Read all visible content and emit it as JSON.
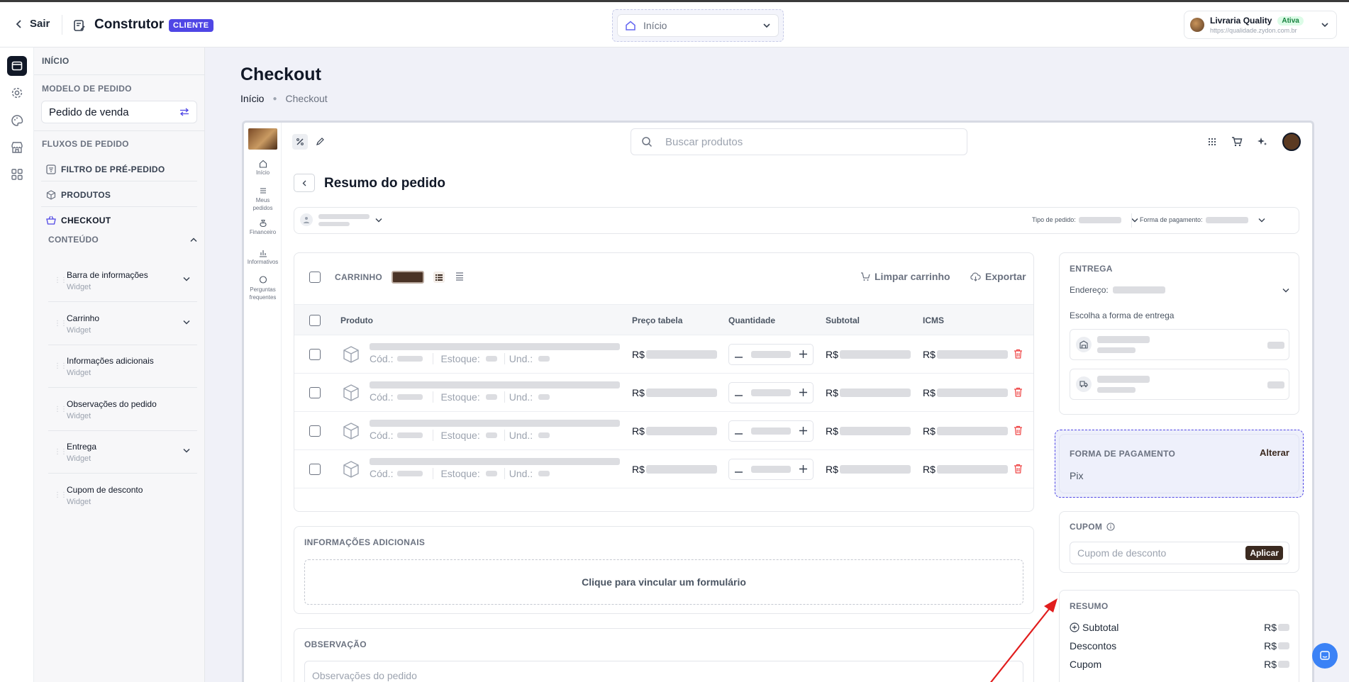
{
  "topbar": {
    "back_label": "Sair",
    "title": "Construtor",
    "badge": "CLIENTE",
    "page_select": "Início",
    "store_name": "Livraria Quality",
    "store_status": "Ativa",
    "store_url": "https://qualidade.zydon.com.br"
  },
  "sidebar": {
    "home": "INÍCIO",
    "order_model_label": "MODELO DE PEDIDO",
    "order_model_value": "Pedido de venda",
    "flows_label": "FLUXOS DE PEDIDO",
    "flows": [
      "FILTRO DE PRÉ-PEDIDO",
      "PRODUTOS",
      "CHECKOUT"
    ],
    "content_label": "CONTEÚDO",
    "widgets": [
      {
        "title": "Barra de informações",
        "sub": "Widget"
      },
      {
        "title": "Carrinho",
        "sub": "Widget"
      },
      {
        "title": "Informações adicionais",
        "sub": "Widget"
      },
      {
        "title": "Observações do pedido",
        "sub": "Widget"
      },
      {
        "title": "Entrega",
        "sub": "Widget"
      },
      {
        "title": "Cupom de desconto",
        "sub": "Widget"
      }
    ]
  },
  "page": {
    "title": "Checkout",
    "breadcrumb": [
      "Início",
      "Checkout"
    ]
  },
  "preview": {
    "nav": [
      {
        "label": "Início"
      },
      {
        "label": "Meus pedidos"
      },
      {
        "label": "Financeiro"
      },
      {
        "label": "Informativos"
      },
      {
        "label": "Perguntas frequentes"
      }
    ],
    "search_placeholder": "Buscar produtos",
    "order_title": "Resumo do pedido",
    "order_type_label": "Tipo de pedido:",
    "payment_form_label": "Forma de pagamento:",
    "cart": {
      "label": "CARRINHO",
      "clear": "Limpar carrinho",
      "export": "Exportar",
      "columns": [
        "Produto",
        "Preço tabela",
        "Quantidade",
        "Subtotal",
        "ICMS"
      ],
      "row_labels": {
        "cod": "Cód.:",
        "stock": "Estoque:",
        "unit": "Und.:",
        "currency": "R$"
      },
      "rows_count_note": "4"
    },
    "additional": {
      "label": "INFORMAÇÕES ADICIONAIS",
      "link": "Clique para vincular um formulário"
    },
    "observation": {
      "label": "OBSERVAÇÃO",
      "placeholder": "Observações do pedido"
    },
    "delivery": {
      "label": "ENTREGA",
      "address_label": "Endereço:",
      "choose": "Escolha a forma de entrega"
    },
    "payment": {
      "label": "FORMA DE PAGAMENTO",
      "change": "Alterar",
      "value": "Pix"
    },
    "coupon": {
      "label": "CUPOM",
      "placeholder": "Cupom de desconto",
      "apply": "Aplicar"
    },
    "summary": {
      "label": "RESUMO",
      "rows": [
        {
          "label": "Subtotal",
          "currency": "R$"
        },
        {
          "label": "Descontos",
          "currency": "R$"
        },
        {
          "label": "Cupom",
          "currency": "R$"
        }
      ]
    }
  },
  "colors": {
    "accent": "#4f46e5",
    "brand_dark": "#3b2a20",
    "annotation": "#e11d1d",
    "chat": "#3b82f6"
  }
}
